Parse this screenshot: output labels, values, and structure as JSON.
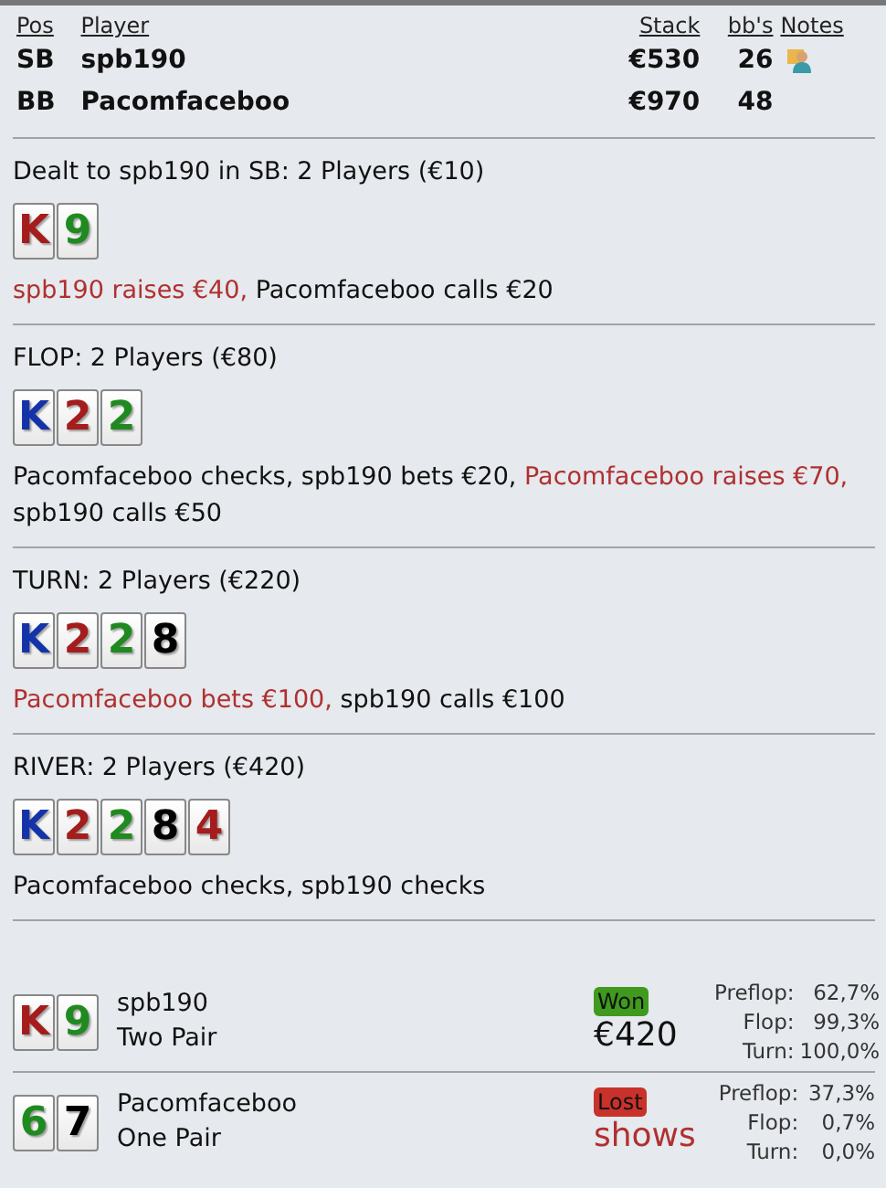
{
  "players_table": {
    "columns": [
      "Pos",
      "Player",
      "Stack",
      "bb's",
      "Notes"
    ],
    "rows": [
      {
        "pos": "SB",
        "player": "spb190",
        "stack": "€530",
        "bbs": "26",
        "has_note": true
      },
      {
        "pos": "BB",
        "player": "Pacomfaceboo",
        "stack": "€970",
        "bbs": "48",
        "has_note": false
      }
    ]
  },
  "streets": [
    {
      "heading": "Dealt to spb190 in SB: 2 Players (€10)",
      "cards": [
        {
          "rank": "K",
          "color": "#a51c1c"
        },
        {
          "rank": "9",
          "color": "#1f8a1f"
        }
      ],
      "actions": [
        {
          "text": "spb190 raises €40,",
          "kind": "aggressive"
        },
        {
          "text": "Pacomfaceboo calls €20",
          "kind": "passive"
        }
      ]
    },
    {
      "heading": "FLOP: 2 Players (€80)",
      "cards": [
        {
          "rank": "K",
          "color": "#1533a8"
        },
        {
          "rank": "2",
          "color": "#a51c1c"
        },
        {
          "rank": "2",
          "color": "#1f8a1f"
        }
      ],
      "actions": [
        {
          "text": "Pacomfaceboo checks,",
          "kind": "passive"
        },
        {
          "text": "spb190 bets €20,",
          "kind": "passive"
        },
        {
          "text": "Pacomfaceboo raises €70,",
          "kind": "aggressive"
        },
        {
          "text": "spb190 calls €50",
          "kind": "passive"
        }
      ]
    },
    {
      "heading": "TURN: 2 Players (€220)",
      "cards": [
        {
          "rank": "K",
          "color": "#1533a8"
        },
        {
          "rank": "2",
          "color": "#a51c1c"
        },
        {
          "rank": "2",
          "color": "#1f8a1f"
        },
        {
          "rank": "8",
          "color": "#000000"
        }
      ],
      "actions": [
        {
          "text": "Pacomfaceboo bets €100,",
          "kind": "aggressive"
        },
        {
          "text": "spb190 calls €100",
          "kind": "passive"
        }
      ]
    },
    {
      "heading": "RIVER: 2 Players (€420)",
      "cards": [
        {
          "rank": "K",
          "color": "#1533a8"
        },
        {
          "rank": "2",
          "color": "#a51c1c"
        },
        {
          "rank": "2",
          "color": "#1f8a1f"
        },
        {
          "rank": "8",
          "color": "#000000"
        },
        {
          "rank": "4",
          "color": "#a51c1c"
        }
      ],
      "actions": [
        {
          "text": "Pacomfaceboo checks,",
          "kind": "passive"
        },
        {
          "text": "spb190 checks",
          "kind": "passive"
        }
      ]
    }
  ],
  "showdown": [
    {
      "cards": [
        {
          "rank": "K",
          "color": "#a51c1c"
        },
        {
          "rank": "9",
          "color": "#1f8a1f"
        }
      ],
      "player": "spb190",
      "hand": "Two Pair",
      "kind": "won",
      "badge": "Won",
      "outcome": "€420",
      "equity": [
        {
          "label": "Preflop:",
          "value": "62,7%"
        },
        {
          "label": "Flop:",
          "value": "99,3%"
        },
        {
          "label": "Turn:",
          "value": "100,0%"
        }
      ]
    },
    {
      "cards": [
        {
          "rank": "6",
          "color": "#1f8a1f"
        },
        {
          "rank": "7",
          "color": "#000000"
        }
      ],
      "player": "Pacomfaceboo",
      "hand": "One Pair",
      "kind": "lost",
      "badge": "Lost",
      "outcome": "shows",
      "equity": [
        {
          "label": "Preflop:",
          "value": "37,3%"
        },
        {
          "label": "Flop:",
          "value": "0,7%"
        },
        {
          "label": "Turn:",
          "value": "0,0%"
        }
      ]
    }
  ]
}
